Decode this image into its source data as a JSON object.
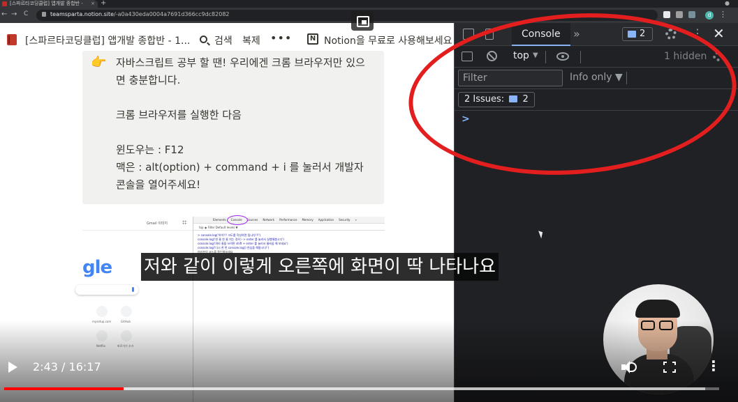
{
  "browser": {
    "tab_title": "[스파르타코딩클럽] 앱개발 종합반 -",
    "tab_close": "×",
    "new_tab": "+",
    "url_domain": "teamsparta.notion.site",
    "url_path": "/-a0a430eda0004a7691d366cc9dc82082",
    "profile_initial": "d",
    "nav_back": "←",
    "nav_forward": "→",
    "nav_reload": "C"
  },
  "notion": {
    "page_title": "[스파르타코딩클럽] 앱개발 종합반 - 1...",
    "search_label": "검색",
    "duplicate_label": "복제",
    "more_label": "•••",
    "notion_logo": "N",
    "try_label": "Notion을 무료로 사용해보세요",
    "callout_icon": "👉",
    "callout_lines": [
      "자바스크립트 공부 할 땐! 우리에겐 크롬 브라우저만 있으면 충분합니다.",
      "크롬 브라우저를 실행한 다음",
      "윈도우는 : F12",
      "맥은 : alt(option) + command + i 를 눌러서 개발자 콘솔을 열어주세요!"
    ]
  },
  "embedded": {
    "google_logo": "gle",
    "gmail_label": "Gmail",
    "images_label": "이미지",
    "shortcuts": [
      "mysetup.com",
      "GitHub",
      "Netflix",
      "바로가기 추가"
    ],
    "devtools_tabs": [
      "Elements",
      "Console",
      "Sources",
      "Network",
      "Performance",
      "Memory",
      "Application",
      "Security",
      "»"
    ],
    "toolbar": "top   ◉   Filter                 Default levels ▼",
    "console_lines": [
      "> console.log('하이!!! 크도를 작성하면 됩니다!!!')",
      "  console.log('한 줄 한 줄 치는 경우) -> enter 를 눌러서 실행해봅시다')",
      "  console.log('여러 줄을 쓰려면 shift + enter 를 눌러서 줄바꿈 해 보세요')",
      "  console.log('다시 한 번 console.log() 연습을 해봅시다!')",
      "  여러분의 코드를 확인해보세요"
    ]
  },
  "devtools": {
    "tab_console": "Console",
    "more_tabs": "»",
    "issues_badge_count": "2",
    "kebab": "⋮",
    "close": "✕",
    "context": "top",
    "context_caret": "▼",
    "hidden_count": "1 hidden",
    "filter_placeholder": "Filter",
    "levels": "Info only ▼",
    "issues_text": "2 Issues:",
    "issues_count": "2",
    "prompt": ">"
  },
  "video": {
    "subtitle": "저와 같이 이렇게 오른쪽에 화면이 딱 나타나요",
    "current_time": "2:43",
    "duration": "16:17",
    "time_separator": "/",
    "more": "⋮",
    "progress_fraction": 0.167,
    "buffered_fraction": 0.98
  },
  "colors": {
    "annotation": "#e31e1e",
    "progress": "#ff0000",
    "devtools_bg": "#202124"
  }
}
